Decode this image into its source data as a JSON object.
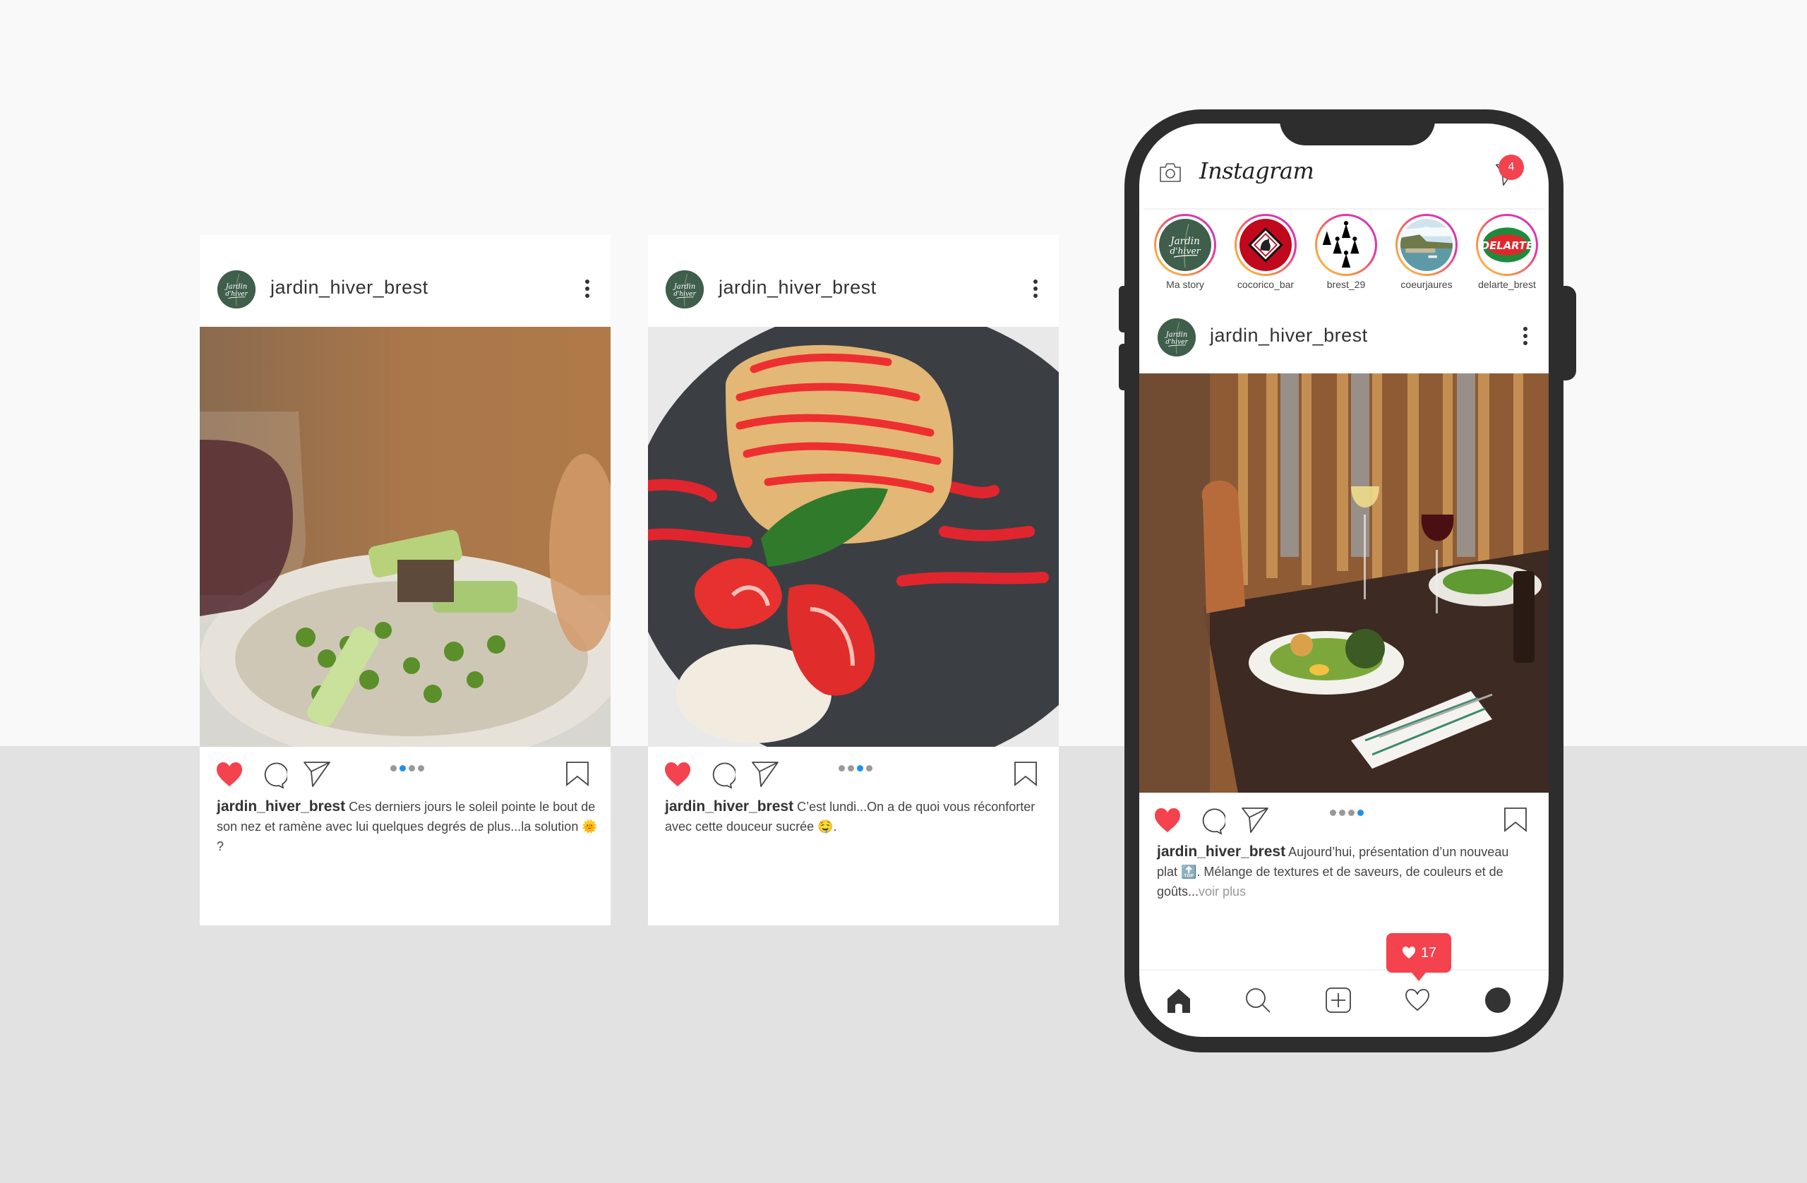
{
  "colors": {
    "like_red": "#f5424f",
    "active_dot": "#1e90f0",
    "brand_green": "#3f5e4c",
    "phone_frame": "#2d2d2d",
    "bg_top": "#f9f9f9",
    "bg_bottom": "#e2e2e2"
  },
  "posts": [
    {
      "username": "jardin_hiver_brest",
      "photo": "Plate of tuna with cucumber, edamame and herbs next to a glass of red wine",
      "carousel_total": 4,
      "carousel_active": 2,
      "caption_user": "jardin_hiver_brest",
      "caption_text": "Ces derniers jours le soleil pointe le bout de son nez et ramène avec lui quelques degrés de plus...la solution 🌞 ?"
    },
    {
      "username": "jardin_hiver_brest",
      "photo": "Sponge cake roll with red coulis, strawberries, basil leaf and cream on a dark plate",
      "carousel_total": 4,
      "carousel_active": 3,
      "caption_user": "jardin_hiver_brest",
      "caption_text": "C’est lundi...On a de quoi vous réconforter avec cette douceur sucrée 🤤."
    }
  ],
  "phone": {
    "app_title": "Instagram",
    "icons": {
      "camera": "camera-icon",
      "direct": "paper-plane-icon"
    },
    "dm_badge": "4",
    "stories": [
      {
        "label": "Ma story",
        "image": "Jardin d'hiver logo"
      },
      {
        "label": "cocorico_bar",
        "image": "rooster diamond logo"
      },
      {
        "label": "brest_29",
        "image": "ermine spots flag"
      },
      {
        "label": "coeurjaures",
        "image": "harbour landscape"
      },
      {
        "label": "delarte_brest",
        "image": "Del Arte logo"
      }
    ],
    "post": {
      "username": "jardin_hiver_brest",
      "photo": "Restaurant table with a plated dish, salad, wine glasses and cutlery",
      "carousel_total": 4,
      "carousel_active": 4,
      "caption_user": "jardin_hiver_brest",
      "caption_text": "Aujourd’hui, présentation d’un nouveau plat 🔝. Mélange de textures et de saveurs, de couleurs et de goûts...",
      "caption_more": "voir plus"
    },
    "likes_popup": "17",
    "tabbar": [
      "home-icon",
      "search-icon",
      "add-post-icon",
      "heart-icon",
      "profile-icon"
    ]
  },
  "story_logos": {
    "jardin": "Jardin d'hiver",
    "delarte": "DELARTE"
  }
}
